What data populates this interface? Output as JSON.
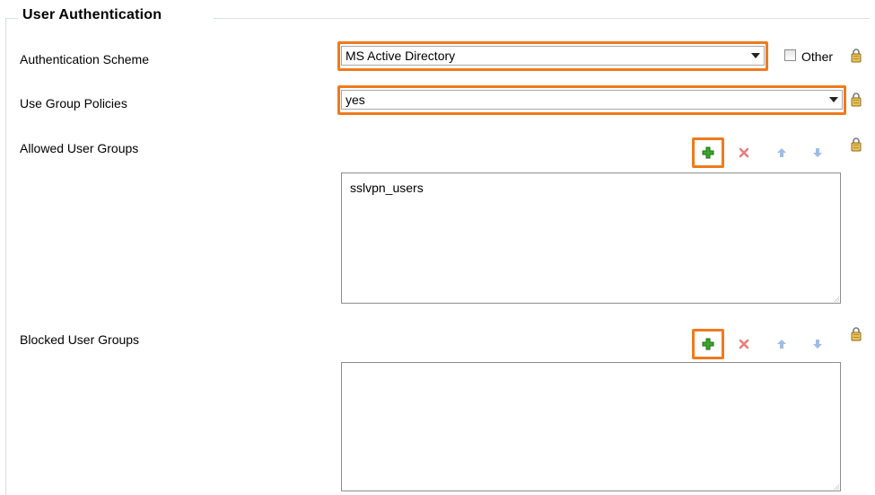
{
  "section": {
    "legend": "User Authentication"
  },
  "auth_scheme": {
    "label": "Authentication Scheme",
    "selected": "MS Active Directory",
    "other_label": "Other",
    "other_checked": false
  },
  "group_policies": {
    "label": "Use Group Policies",
    "selected": "yes"
  },
  "allowed_groups": {
    "label": "Allowed User Groups",
    "items": [
      "sslvpn_users"
    ]
  },
  "blocked_groups": {
    "label": "Blocked User Groups",
    "items": []
  },
  "icons": {
    "add": "add-icon",
    "delete": "delete-icon",
    "move_up": "arrow-up-icon",
    "move_down": "arrow-down-icon",
    "lock": "lock-icon",
    "dropdown": "chevron-down-icon"
  },
  "colors": {
    "highlight": "#f07a1c",
    "add_green": "#3aa62a",
    "delete_red": "#e05454",
    "arrow_blue": "#8fb2de"
  }
}
